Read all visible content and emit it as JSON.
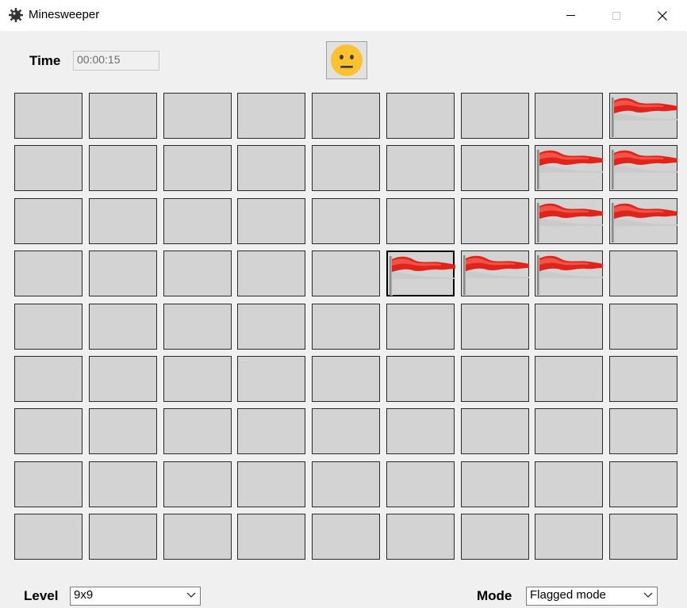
{
  "window": {
    "title": "Minesweeper",
    "app_icon": "mine-gear-icon",
    "controls": [
      "minimize-icon",
      "maximize-icon",
      "close-icon"
    ]
  },
  "header": {
    "time_label": "Time",
    "time_value": "00:00:15",
    "face_icon": "neutral-face-icon"
  },
  "board": {
    "rows": 9,
    "cols": 9,
    "cells": [
      [
        "",
        "",
        "",
        "",
        "",
        "",
        "",
        "",
        "flag"
      ],
      [
        "",
        "",
        "",
        "",
        "",
        "",
        "",
        "flag",
        "flag"
      ],
      [
        "",
        "",
        "",
        "",
        "",
        "",
        "",
        "flag",
        "flag"
      ],
      [
        "",
        "",
        "",
        "",
        "",
        "flag",
        "flag",
        "flag",
        ""
      ],
      [
        "",
        "",
        "",
        "",
        "",
        "",
        "",
        "",
        ""
      ],
      [
        "",
        "",
        "",
        "",
        "",
        "",
        "",
        "",
        ""
      ],
      [
        "",
        "",
        "",
        "",
        "",
        "",
        "",
        "",
        ""
      ],
      [
        "",
        "",
        "",
        "",
        "",
        "",
        "",
        "",
        ""
      ],
      [
        "",
        "",
        "",
        "",
        "",
        "",
        "",
        "",
        ""
      ]
    ],
    "selected_cell": {
      "row": 4,
      "col": 6
    },
    "flag_icon": "red-flag-icon"
  },
  "footer": {
    "level_label": "Level",
    "level_value": "9x9",
    "mode_label": "Mode",
    "mode_value": "Flagged mode"
  },
  "colors": {
    "cell_fill": "#d3d3d3",
    "flag_red": "#e0241b",
    "face_yellow": "#fbc12e"
  }
}
